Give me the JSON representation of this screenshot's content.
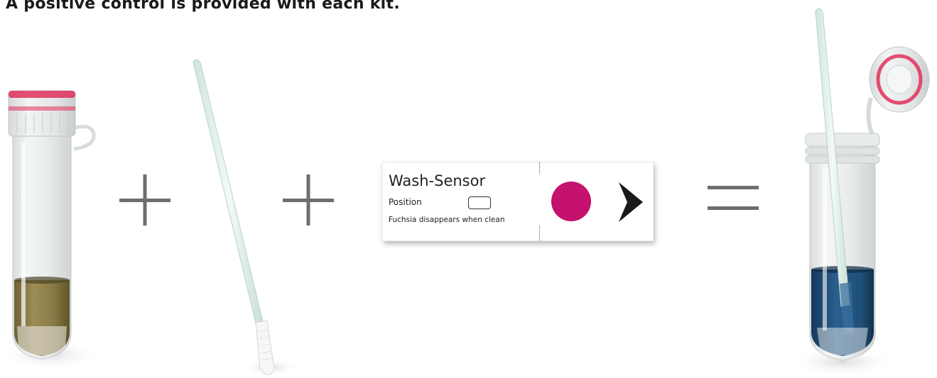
{
  "heading": "A positive control is provided with each kit.",
  "operators": {
    "plus_1": "plus",
    "plus_2": "plus",
    "equals": "equals"
  },
  "sensor_card": {
    "title": "Wash-Sensor",
    "position_label": "Position",
    "note": "Fuchsia disappears when clean",
    "indicator_color": "#c4126e"
  },
  "colors": {
    "operator": "#6e6e6e",
    "cap_ring": "#e0305a",
    "tube_liquid_before": "#8a7a45",
    "tube_liquid_after": "#1f4f7a",
    "swab": "#e4f2ec"
  }
}
